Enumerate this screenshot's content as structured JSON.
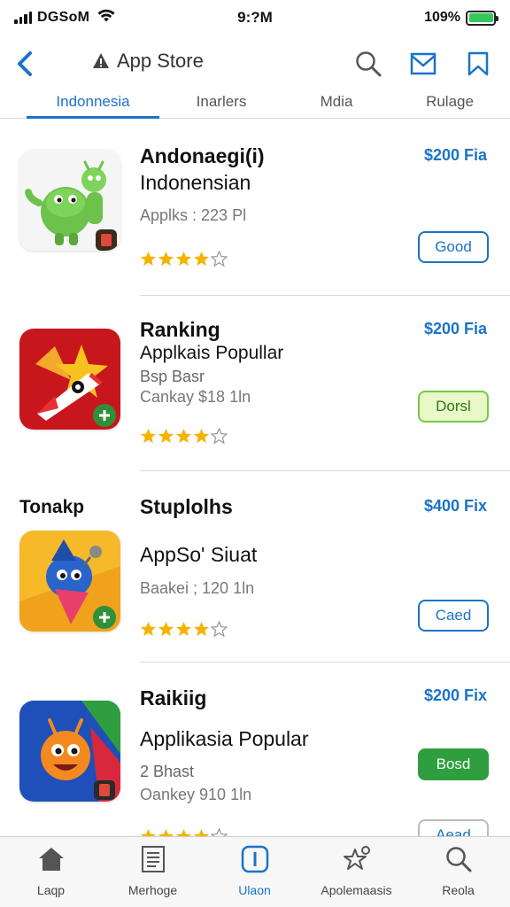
{
  "status_bar": {
    "carrier": "DGSoM",
    "time": "9:?M",
    "battery_percent": "109%",
    "battery_color": "#34c759"
  },
  "nav": {
    "back_icon": "chevron-left-icon",
    "title": "App Store",
    "title_icon": "warning-icon",
    "icons": [
      "search-icon",
      "mail-icon",
      "bookmark-icon"
    ],
    "accent": "#1a73c8"
  },
  "tabs": [
    {
      "label": "Indonnesia",
      "active": true
    },
    {
      "label": "Inarlers",
      "active": false
    },
    {
      "label": "Mdia",
      "active": false
    },
    {
      "label": "Rulage",
      "active": false
    }
  ],
  "apps": [
    {
      "title": "Andonaegi(i)",
      "subtitle": "Indonensian",
      "meta": "Applks : 223 Pl",
      "price": "$200 Fia",
      "rating": 4,
      "button": "Good",
      "icon": "android-robot-icon"
    },
    {
      "title": "Ranking",
      "subtitle": "Applkais Popullar",
      "rank_label": "Bsp Basr",
      "meta": "Cankay $18 1ln",
      "price": "$200 Fia",
      "rating": 4,
      "button": "Dorsl",
      "icon": "rocket-star-icon"
    },
    {
      "side_label": "Tonakp",
      "title": "Stuplolhs",
      "subtitle": "AppSo' Siuat",
      "meta": "Baakei ; 120 1ln",
      "price": "$400 Fix",
      "rating": 4,
      "button": "Caed",
      "icon": "blue-creature-icon"
    },
    {
      "title": "Raikiig",
      "subtitle": "Applikasia Popular",
      "rank_label": "2 Bhast",
      "meta": "Oankey 910 1ln",
      "price": "$200 Fix",
      "rating": 4,
      "button": "Bosd",
      "icon": "orange-monster-icon"
    }
  ],
  "partial_button": "Aead",
  "tab_bar": [
    {
      "label": "Laqp",
      "icon": "home-icon",
      "active": false
    },
    {
      "label": "Merhoge",
      "icon": "document-icon",
      "active": false
    },
    {
      "label": "Ulaon",
      "icon": "updates-icon",
      "active": true
    },
    {
      "label": "Apolemaasis",
      "icon": "star-person-icon",
      "active": false
    },
    {
      "label": "Reola",
      "icon": "search-icon",
      "active": false
    }
  ]
}
